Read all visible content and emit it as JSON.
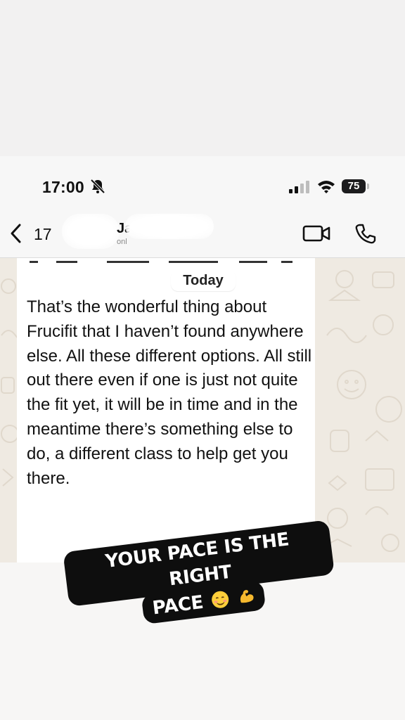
{
  "status_bar": {
    "time": "17:00",
    "battery": "75"
  },
  "chat_header": {
    "unread_count": "17",
    "contact_name": "Ja",
    "contact_status": "onl"
  },
  "date_separator": "Today",
  "message": {
    "text": "That’s the wonderful thing about Frucifit that I haven’t found anywhere else. All these different options. All still out there even if one is just not quite the fit yet, it will be in time and in the meantime there’s something else to do, a different class to help get you there."
  },
  "sticker": {
    "line1": "YOUR PACE IS THE RIGHT",
    "line2": "PACE",
    "emojis": [
      "smiling-face-icon",
      "flexed-biceps-icon"
    ]
  },
  "icons": {
    "back": "chevron-left-icon",
    "video": "video-camera-icon",
    "phone": "phone-icon",
    "bell": "bell-slash-icon",
    "signal": "cellular-signal-icon",
    "wifi": "wifi-icon"
  },
  "colors": {
    "wallpaper": "#efeae2",
    "bubble": "#ffffff",
    "sticker_bg": "#0e0e0e",
    "sticker_text": "#ffffff"
  }
}
